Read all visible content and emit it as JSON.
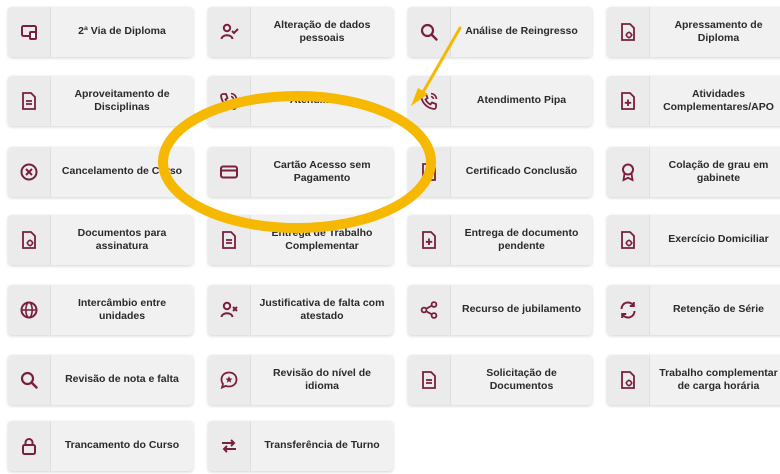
{
  "services": [
    {
      "label": "2ª Via de Diploma",
      "icon": "laptop-icon"
    },
    {
      "label": "Alteração de dados pessoais",
      "icon": "user-check-icon"
    },
    {
      "label": "Análise de Reingresso",
      "icon": "search-icon"
    },
    {
      "label": "Apressamento de Diploma",
      "icon": "document-gear-icon"
    },
    {
      "label": "Aproveitamento de Disciplinas",
      "icon": "document-lines-icon"
    },
    {
      "label": "Atendimento",
      "icon": "phone-call-icon"
    },
    {
      "label": "Atendimento Pipa",
      "icon": "phone-call-icon"
    },
    {
      "label": "Atividades Complementares/APO",
      "icon": "document-plus-icon"
    },
    {
      "label": "Cancelamento de Curso",
      "icon": "close-circle-icon"
    },
    {
      "label": "Cartão Acesso sem Pagamento",
      "icon": "credit-card-icon"
    },
    {
      "label": "Certificado Conclusão",
      "icon": "document-lines-icon"
    },
    {
      "label": "Colação de grau em gabinete",
      "icon": "award-icon"
    },
    {
      "label": "Documentos para assinatura",
      "icon": "document-gear-icon"
    },
    {
      "label": "Entrega de Trabalho Complementar",
      "icon": "document-lines-icon"
    },
    {
      "label": "Entrega de documento pendente",
      "icon": "document-plus-icon"
    },
    {
      "label": "Exercício Domiciliar",
      "icon": "document-gear-icon"
    },
    {
      "label": "Intercâmbio entre unidades",
      "icon": "globe-icon"
    },
    {
      "label": "Justificativa de falta com atestado",
      "icon": "user-x-icon"
    },
    {
      "label": "Recurso de jubilamento",
      "icon": "share-icon"
    },
    {
      "label": "Retenção de Série",
      "icon": "refresh-icon"
    },
    {
      "label": "Revisão de nota e falta",
      "icon": "search-icon"
    },
    {
      "label": "Revisão do nível de idioma",
      "icon": "chat-star-icon"
    },
    {
      "label": "Solicitação de Documentos",
      "icon": "document-lines-icon"
    },
    {
      "label": "Trabalho complementar de carga horária",
      "icon": "document-gear-icon"
    },
    {
      "label": "Trancamento do Curso",
      "icon": "lock-icon"
    },
    {
      "label": "Transferência de Turno",
      "icon": "swap-icon"
    }
  ],
  "colors": {
    "icon_accent": "#7a1f3d",
    "annotation_yellow": "#f6b800",
    "card_bg": "#f1f1f2"
  }
}
